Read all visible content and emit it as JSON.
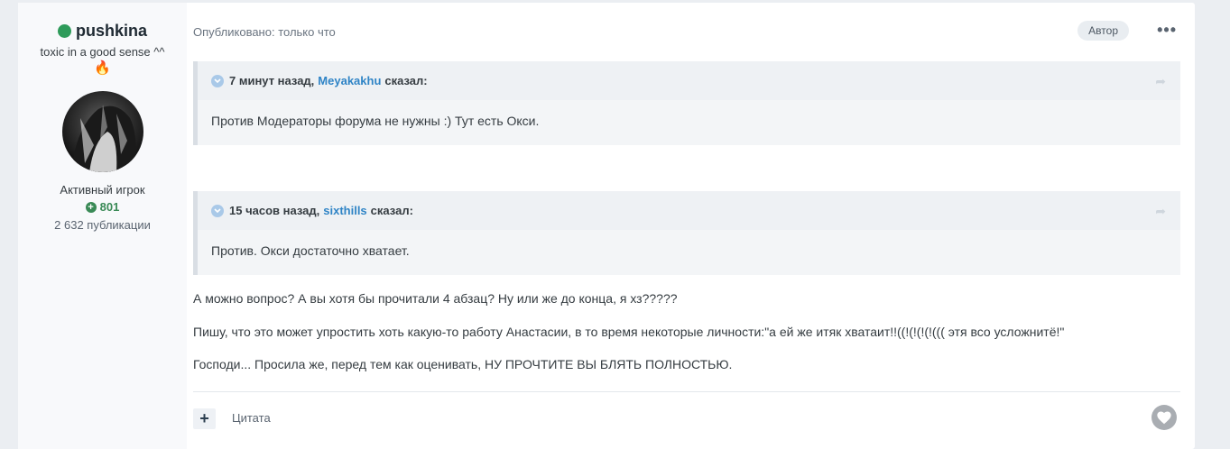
{
  "author": {
    "name": "pushkina",
    "title": "toxic in a good sense ^^",
    "title_emoji": "🔥",
    "rank": "Активный игрок",
    "reputation": "801",
    "post_count": "2 632 публикации"
  },
  "post": {
    "meta": "Опубликовано: только что",
    "author_badge": "Автор",
    "more_label": "•••",
    "quotes": [
      {
        "time": "7 минут назад,",
        "user": "Meyakakhu",
        "said": "сказал:",
        "text": "Против Модераторы форума не нужны :) Тут есть Окси."
      },
      {
        "time": "15 часов назад,",
        "user": "sixthills",
        "said": "сказал:",
        "text": "Против. Окси достаточно хватает."
      }
    ],
    "paragraphs": [
      "А можно вопрос? А вы хотя бы прочитали 4 абзац? Ну или же до конца, я хз?????",
      "Пишу, что это может упростить хоть какую-то работу Анастасии, в то время некоторые личности:\"а ей же итяк хватаит!!((!(!(!(!((( этя всо усложнитё!\"",
      "Господи... Просила же, перед тем как оценивать, НУ ПРОЧТИТЕ ВЫ БЛЯТЬ ПОЛНОСТЬЮ."
    ],
    "quote_action": "Цитата"
  },
  "colors": {
    "online": "#2e9b5a",
    "link": "#2f84c6",
    "reputation": "#3a8a56"
  }
}
